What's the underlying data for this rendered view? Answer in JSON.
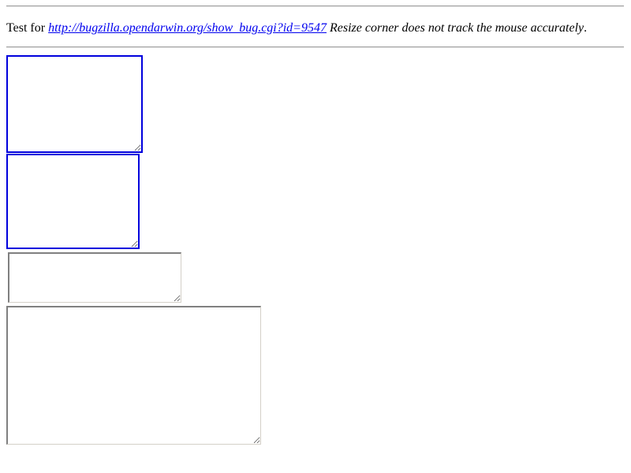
{
  "header": {
    "prefix": "Test for ",
    "link_text": "http://bugzilla.opendarwin.org/show_bug.cgi?id=9547",
    "bug_title": " Resize corner does not track the mouse accurately",
    "suffix": "."
  },
  "textareas": [
    {
      "value": ""
    },
    {
      "value": ""
    },
    {
      "value": ""
    },
    {
      "value": ""
    }
  ],
  "colors": {
    "link": "#0000ee",
    "focus_border": "#0000dd",
    "rule": "#9a9a9a"
  }
}
